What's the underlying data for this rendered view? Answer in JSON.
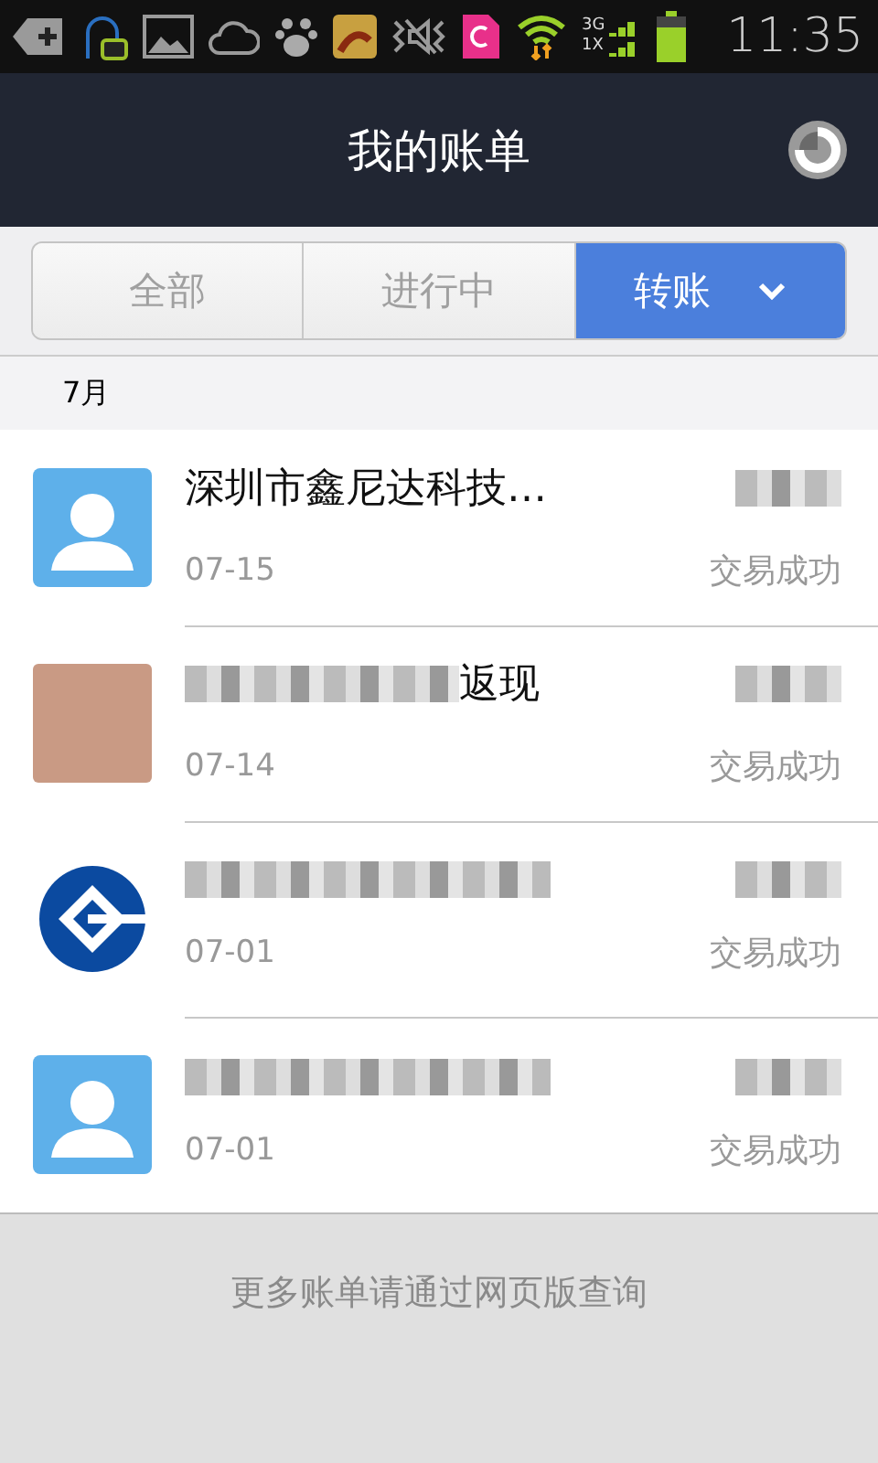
{
  "status_bar": {
    "time": "11:35",
    "network_labels": [
      "3G",
      "1X"
    ]
  },
  "header": {
    "title": "我的账单"
  },
  "tabs": [
    {
      "label": "全部",
      "selected": false,
      "dropdown": false
    },
    {
      "label": "进行中",
      "selected": false,
      "dropdown": false
    },
    {
      "label": "转账",
      "selected": true,
      "dropdown": true
    }
  ],
  "month": "7月",
  "bills": [
    {
      "kind": "person",
      "title": "深圳市鑫尼达科技…",
      "masked": false,
      "date": "07-15",
      "status": "交易成功"
    },
    {
      "kind": "photo",
      "title": "返现",
      "masked": true,
      "date": "07-14",
      "status": "交易成功"
    },
    {
      "kind": "logo",
      "masked": true,
      "date": "07-01",
      "status": "交易成功"
    },
    {
      "kind": "person",
      "masked": true,
      "date": "07-01",
      "status": "交易成功"
    }
  ],
  "footer": {
    "note": "更多账单请通过网页版查询"
  }
}
